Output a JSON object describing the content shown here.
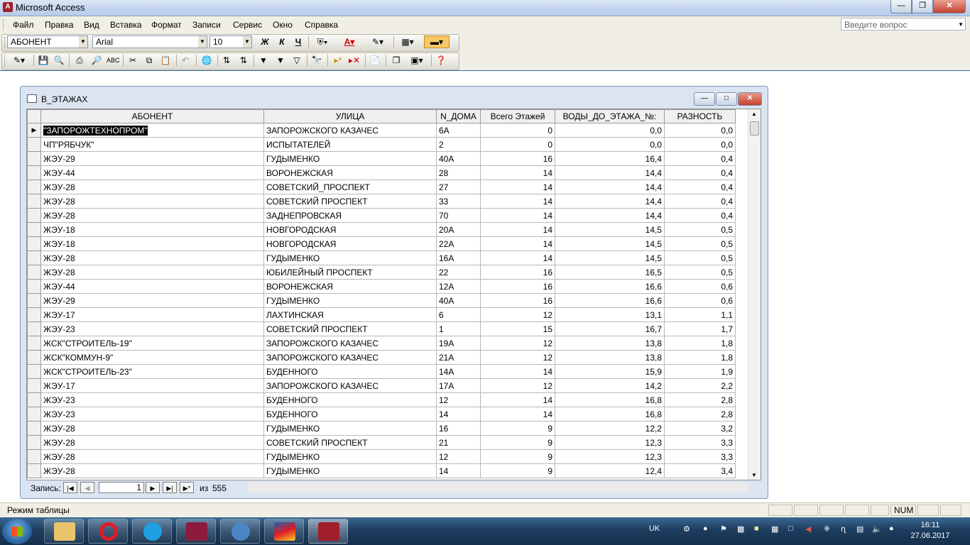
{
  "window": {
    "title": "Microsoft Access"
  },
  "menu": [
    "Файл",
    "Правка",
    "Вид",
    "Вставка",
    "Формат",
    "Записи",
    "Сервис",
    "Окно",
    "Справка"
  ],
  "help_box": {
    "placeholder": "Введите вопрос"
  },
  "format_toolbar": {
    "field": "АБОНЕНТ",
    "font": "Arial",
    "size": "10",
    "bold": "Ж",
    "italic": "К",
    "underline": "Ч"
  },
  "child": {
    "title": "В_ЭТАЖАХ",
    "columns": [
      "АБОНЕНТ",
      "УЛИЦА",
      "N_ДОМА",
      "Всего Этажей",
      "ВОДЫ_ДО_ЭТАЖА_№:",
      "РАЗНОСТЬ"
    ],
    "rows": [
      [
        "\"ЗАПОРОЖТЕХНОПРОМ\"",
        "ЗАПОРОЖСКОГО КАЗАЧЕС",
        "6А",
        "0",
        "0,0",
        "0,0"
      ],
      [
        "ЧП\"РЯБЧУК\"",
        "ИСПЫТАТЕЛЕЙ",
        "2",
        "0",
        "0,0",
        "0,0"
      ],
      [
        "ЖЭУ-29",
        "ГУДЫМЕНКО",
        "40А",
        "16",
        "16,4",
        "0,4"
      ],
      [
        "ЖЭУ-44",
        "ВОРОНЕЖСКАЯ",
        "28",
        "14",
        "14,4",
        "0,4"
      ],
      [
        "ЖЭУ-28",
        "СОВЕТСКИЙ_ПРОСПЕКТ",
        "27",
        "14",
        "14,4",
        "0,4"
      ],
      [
        "ЖЭУ-28",
        "СОВЕТСКИЙ ПРОСПЕКТ",
        "33",
        "14",
        "14,4",
        "0,4"
      ],
      [
        "ЖЭУ-28",
        "ЗАДНЕПРОВСКАЯ",
        "70",
        "14",
        "14,4",
        "0,4"
      ],
      [
        "ЖЭУ-18",
        "НОВГОРОДСКАЯ",
        "20А",
        "14",
        "14,5",
        "0,5"
      ],
      [
        "ЖЭУ-18",
        "НОВГОРОДСКАЯ",
        "22А",
        "14",
        "14,5",
        "0,5"
      ],
      [
        "ЖЭУ-28",
        "ГУДЫМЕНКО",
        "16А",
        "14",
        "14,5",
        "0,5"
      ],
      [
        "ЖЭУ-28",
        "ЮБИЛЕЙНЫЙ ПРОСПЕКТ",
        "22",
        "16",
        "16,5",
        "0,5"
      ],
      [
        "ЖЭУ-44",
        "ВОРОНЕЖСКАЯ",
        "12А",
        "16",
        "16,6",
        "0,6"
      ],
      [
        "ЖЭУ-29",
        "ГУДЫМЕНКО",
        "40А",
        "16",
        "16,6",
        "0,6"
      ],
      [
        "ЖЭУ-17",
        "ЛАХТИНСКАЯ",
        "6",
        "12",
        "13,1",
        "1,1"
      ],
      [
        "ЖЭУ-23",
        "СОВЕТСКИЙ ПРОСПЕКТ",
        "1",
        "15",
        "16,7",
        "1,7"
      ],
      [
        "ЖСК\"СТРОИТЕЛЬ-19\"",
        "ЗАПОРОЖСКОГО КАЗАЧЕС",
        "19А",
        "12",
        "13,8",
        "1,8"
      ],
      [
        "ЖСК\"КОММУН-9\"",
        "ЗАПОРОЖСКОГО КАЗАЧЕС",
        "21А",
        "12",
        "13,8",
        "1,8"
      ],
      [
        "ЖСК\"СТРОИТЕЛЬ-23\"",
        "БУДЕННОГО",
        "14А",
        "14",
        "15,9",
        "1,9"
      ],
      [
        "ЖЭУ-17",
        "ЗАПОРОЖСКОГО КАЗАЧЕС",
        "17А",
        "12",
        "14,2",
        "2,2"
      ],
      [
        "ЖЭУ-23",
        "БУДЕННОГО",
        "12",
        "14",
        "16,8",
        "2,8"
      ],
      [
        "ЖЭУ-23",
        "БУДЕННОГО",
        "14",
        "14",
        "16,8",
        "2,8"
      ],
      [
        "ЖЭУ-28",
        "ГУДЫМЕНКО",
        "16",
        "9",
        "12,2",
        "3,2"
      ],
      [
        "ЖЭУ-28",
        "СОВЕТСКИЙ ПРОСПЕКТ",
        "21",
        "9",
        "12,3",
        "3,3"
      ],
      [
        "ЖЭУ-28",
        "ГУДЫМЕНКО",
        "12",
        "9",
        "12,3",
        "3,3"
      ],
      [
        "ЖЭУ-28",
        "ГУДЫМЕНКО",
        "14",
        "9",
        "12,4",
        "3,4"
      ]
    ],
    "nav": {
      "label": "Запись:",
      "current": "1",
      "of": "из",
      "total": "555"
    }
  },
  "status": {
    "text": "Режим таблицы",
    "num": "NUM"
  },
  "taskbar": {
    "lang": "UK",
    "time": "16:11",
    "date": "27.06.2017",
    "apps": [
      "file-explorer",
      "opera",
      "skype",
      "floppy-app",
      "media-app",
      "paint-app",
      "access"
    ]
  }
}
